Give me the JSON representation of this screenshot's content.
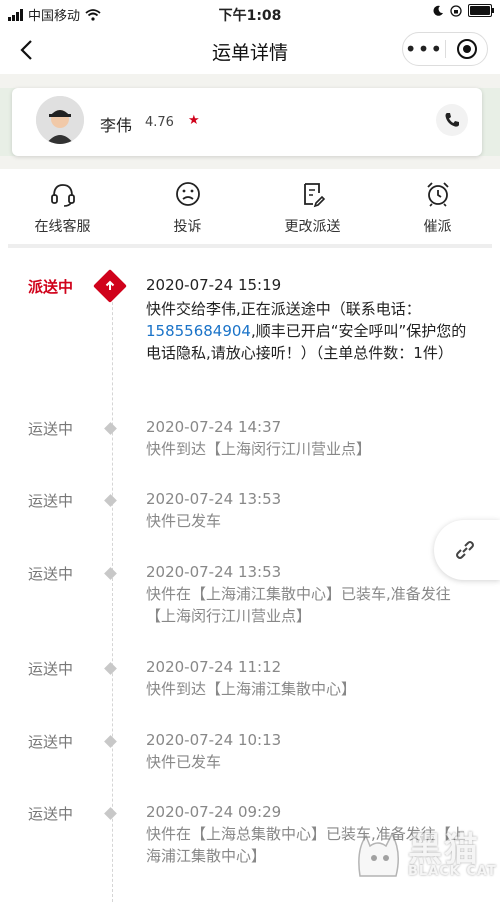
{
  "status_bar": {
    "carrier": "中国移动",
    "time": "下午1:08",
    "battery_level": 0.9
  },
  "nav": {
    "title": "运单详情",
    "more": "•••"
  },
  "driver": {
    "name": "李伟",
    "rating": "4.76",
    "star": "★"
  },
  "actions": [
    {
      "label": "在线客服",
      "icon": "headset-icon"
    },
    {
      "label": "投诉",
      "icon": "sad-face-icon"
    },
    {
      "label": "更改派送",
      "icon": "edit-document-icon"
    },
    {
      "label": "催派",
      "icon": "alarm-clock-icon"
    }
  ],
  "timeline": [
    {
      "status": "派送中",
      "time": "2020-07-24 15:19",
      "desc_pre": "快件交给李伟,正在派送途中（联系电话：",
      "phone": "15855684904",
      "desc_post": ",顺丰已开启“安全呼叫”保护您的电话隐私,请放心接听！）（主单总件数：1件）"
    },
    {
      "status": "运送中",
      "time": "2020-07-24 14:37",
      "desc": "快件到达【上海闵行江川营业点】"
    },
    {
      "status": "运送中",
      "time": "2020-07-24 13:53",
      "desc": "快件已发车"
    },
    {
      "status": "运送中",
      "time": "2020-07-24 13:53",
      "desc": "快件在【上海浦江集散中心】已装车,准备发往【上海闵行江川营业点】"
    },
    {
      "status": "运送中",
      "time": "2020-07-24 11:12",
      "desc": "快件到达【上海浦江集散中心】"
    },
    {
      "status": "运送中",
      "time": "2020-07-24 10:13",
      "desc": "快件已发车"
    },
    {
      "status": "运送中",
      "time": "2020-07-24 09:29",
      "desc": "快件在【上海总集散中心】已装车,准备发往【上海浦江集散中心】"
    }
  ],
  "watermark": {
    "cn": "黑猫",
    "en": "BLACK CAT"
  },
  "colors": {
    "accent": "#d0021b",
    "link": "#1a73c8"
  }
}
